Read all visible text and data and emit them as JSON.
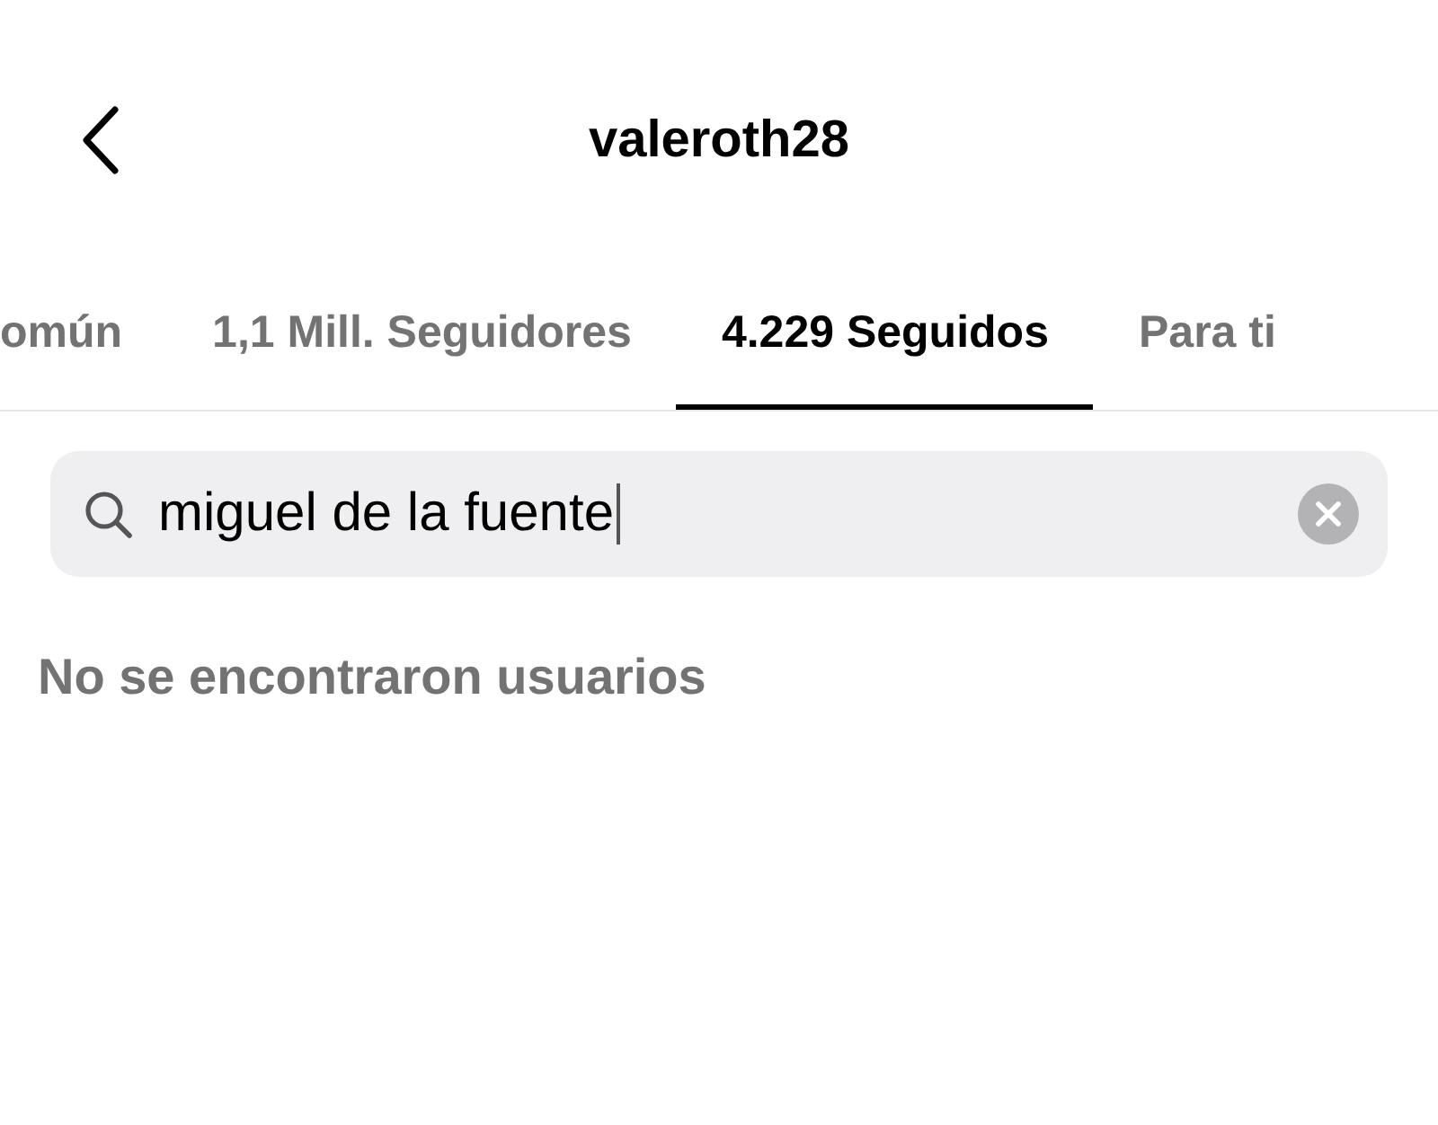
{
  "header": {
    "title": "valeroth28"
  },
  "tabs": [
    {
      "label": "omún",
      "selected": false
    },
    {
      "label": "1,1 Mill. Seguidores",
      "selected": false
    },
    {
      "label": "4.229 Seguidos",
      "selected": true
    },
    {
      "label": "Para ti",
      "selected": false
    }
  ],
  "search": {
    "value": "miguel de la fuente",
    "focused": true
  },
  "message": "No se encontraron usuarios"
}
